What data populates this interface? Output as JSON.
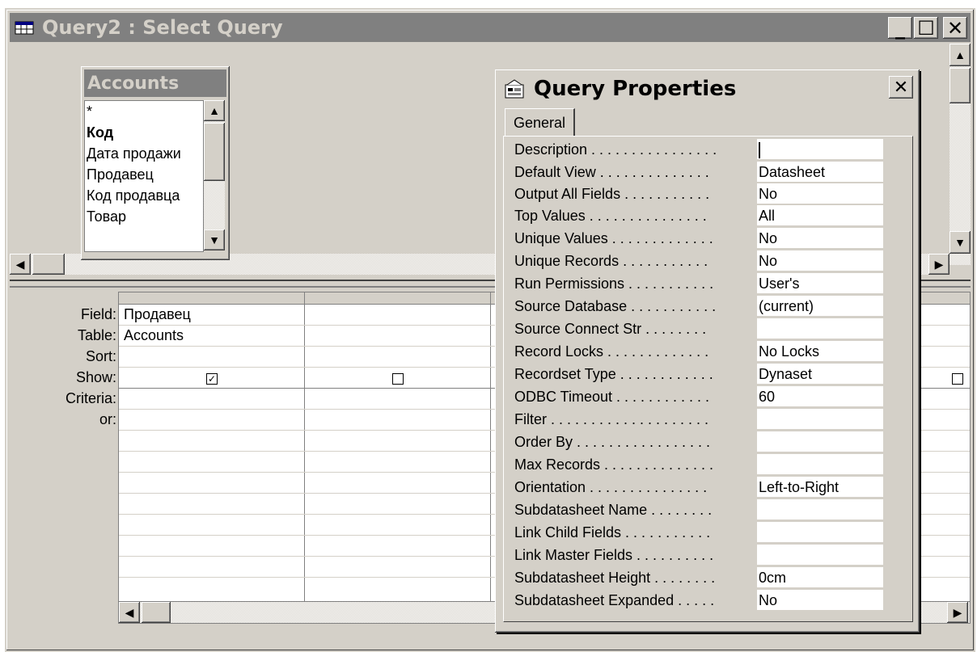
{
  "window": {
    "title": "Query2 : Select Query",
    "icon": "query-icon",
    "minimize": "_",
    "maximize": "☐",
    "close": "✕"
  },
  "field_list": {
    "title": "Accounts",
    "items": [
      "*",
      "Код",
      "Дата продажи",
      "Продавец",
      "Код продавца",
      "Товар"
    ]
  },
  "grid": {
    "row_labels": [
      "Field:",
      "Table:",
      "Sort:",
      "Show:",
      "Criteria:",
      "or:"
    ],
    "columns": [
      {
        "field": "Продавец",
        "table": "Accounts",
        "sort": "",
        "show": true
      },
      {
        "field": "",
        "table": "",
        "sort": "",
        "show": false
      },
      {
        "field": "",
        "table": "",
        "sort": "",
        "show": false
      }
    ]
  },
  "dialog": {
    "title": "Query Properties",
    "close": "✕",
    "tab": "General",
    "properties": [
      {
        "label": "Description . . . . . . . . . . . . . . . .",
        "value": ""
      },
      {
        "label": "Default View . . . . . . . . . . . . . .",
        "value": "Datasheet"
      },
      {
        "label": "Output All Fields . . . . . . . . . . .",
        "value": "No"
      },
      {
        "label": "Top Values . . . . . . . . . . . . . . .",
        "value": "All"
      },
      {
        "label": "Unique Values . . . . . . . . . . . . .",
        "value": "No"
      },
      {
        "label": "Unique Records . . . . . . . . . . .",
        "value": "No"
      },
      {
        "label": "Run Permissions . . . . . . . . . . .",
        "value": "User's"
      },
      {
        "label": "Source Database . . . . . . . . . . .",
        "value": "(current)"
      },
      {
        "label": "Source Connect Str . . . . . . . .",
        "value": ""
      },
      {
        "label": "Record Locks . . . . . . . . . . . . .",
        "value": "No Locks"
      },
      {
        "label": "Recordset Type . . . . . . . . . . . .",
        "value": "Dynaset"
      },
      {
        "label": "ODBC Timeout . . . . . . . . . . . .",
        "value": "60"
      },
      {
        "label": "Filter . . . . . . . . . . . . . . . . . . . .",
        "value": ""
      },
      {
        "label": "Order By . . . . . . . . . . . . . . . . .",
        "value": ""
      },
      {
        "label": "Max Records . . . . . . . . . . . . . .",
        "value": ""
      },
      {
        "label": "Orientation . . . . . . . . . . . . . . .",
        "value": "Left-to-Right"
      },
      {
        "label": "Subdatasheet Name . . . . . . . .",
        "value": ""
      },
      {
        "label": "Link Child Fields . . . . . . . . . . .",
        "value": ""
      },
      {
        "label": "Link Master Fields . . . . . . . . . .",
        "value": ""
      },
      {
        "label": "Subdatasheet Height . . . . . . . .",
        "value": "0cm"
      },
      {
        "label": "Subdatasheet Expanded . . . . .",
        "value": "No"
      }
    ]
  }
}
